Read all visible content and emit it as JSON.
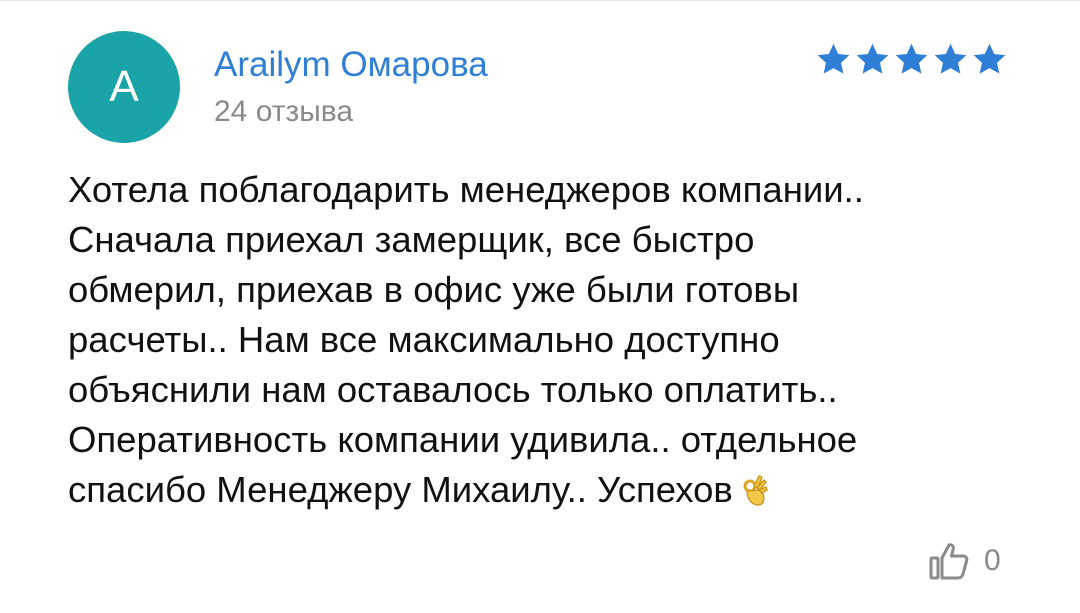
{
  "review": {
    "avatar_letter": "A",
    "avatar_color": "#1aa4a8",
    "author_name": "Arailym Омарова",
    "author_color": "#2f7fd6",
    "review_count": "24 отзыва",
    "rating": 5,
    "rating_max": 5,
    "star_color": "#2f7fd6",
    "text_lines": [
      "Хотела поблагодарить менеджеров компании..",
      "Сначала приехал замерщик, все быстро",
      "обмерил, приехав в офис уже были готовы",
      "расчеты.. Нам все максимально доступно",
      "объяснили нам оставалось только оплатить..",
      "Оперативность компании удивила.. отдельное",
      "спасибо Менеджеру Михаилу.. Успехов"
    ],
    "emoji_icon": "ok-hand-icon",
    "like_icon": "thumbs-up-icon",
    "like_count": "0"
  }
}
